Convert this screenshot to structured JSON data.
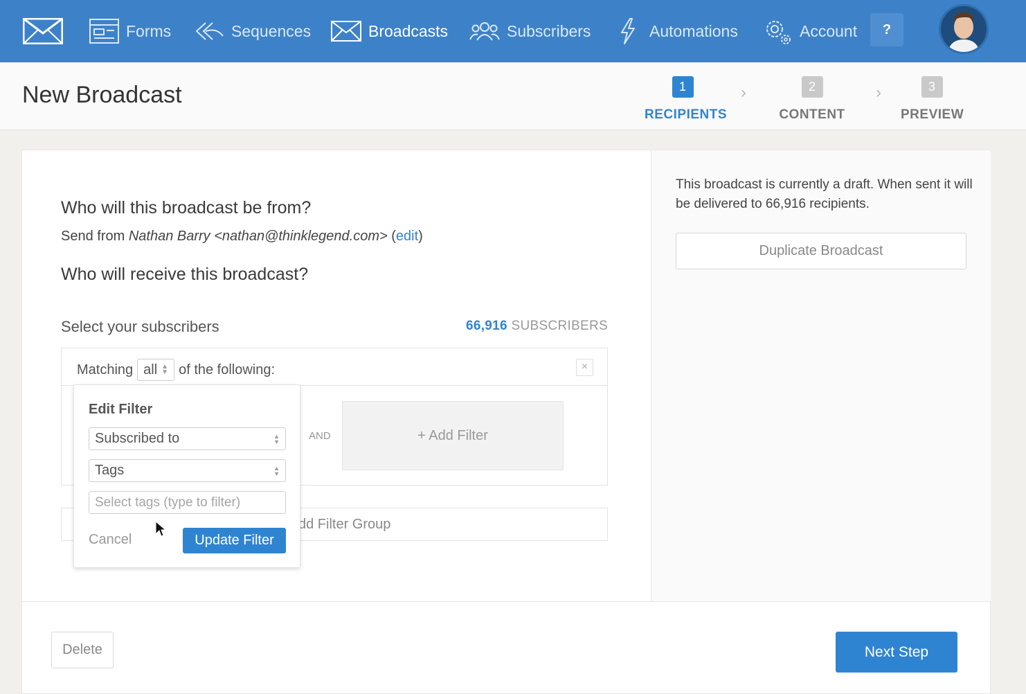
{
  "nav": {
    "items": [
      {
        "label": "Forms",
        "icon": "forms-icon"
      },
      {
        "label": "Sequences",
        "icon": "sequences-icon"
      },
      {
        "label": "Broadcasts",
        "icon": "broadcasts-icon",
        "active": true
      },
      {
        "label": "Subscribers",
        "icon": "subscribers-icon"
      },
      {
        "label": "Automations",
        "icon": "lightning-icon"
      },
      {
        "label": "Account",
        "icon": "gear-icon"
      }
    ],
    "help_label": "?",
    "colors": {
      "bar": "#3d82c8",
      "accent": "#2f84d1"
    }
  },
  "header": {
    "title": "New Broadcast",
    "steps": [
      {
        "num": "1",
        "label": "RECIPIENTS",
        "active": true
      },
      {
        "num": "2",
        "label": "CONTENT"
      },
      {
        "num": "3",
        "label": "PREVIEW"
      }
    ]
  },
  "main": {
    "from_heading": "Who will this broadcast be from?",
    "send_from_prefix": "Send from ",
    "send_from_name": "Nathan Barry <nathan@thinklegend.com>",
    "edit_open": " (",
    "edit_link": "edit",
    "edit_close": ")",
    "receive_heading": "Who will receive this broadcast?",
    "select_label": "Select your subscribers",
    "subscriber_count": "66,916",
    "subscriber_suffix": " SUBSCRIBERS",
    "filter": {
      "matching_prefix": "Matching",
      "matching_value": "all",
      "matching_suffix": "of the following:",
      "close": "×",
      "and_label": "AND",
      "add_filter": "+ Add Filter"
    },
    "add_group_visible_text": "dd Filter Group"
  },
  "popover": {
    "title": "Edit Filter",
    "condition_value": "Subscribed to",
    "type_value": "Tags",
    "tags_placeholder": "Select tags (type to filter)",
    "cancel": "Cancel",
    "update": "Update Filter"
  },
  "sidebar": {
    "draft_text": "This broadcast is currently a draft. When sent it will be delivered to 66,916 recipients.",
    "duplicate": "Duplicate Broadcast"
  },
  "footer": {
    "delete": "Delete",
    "next": "Next Step"
  }
}
